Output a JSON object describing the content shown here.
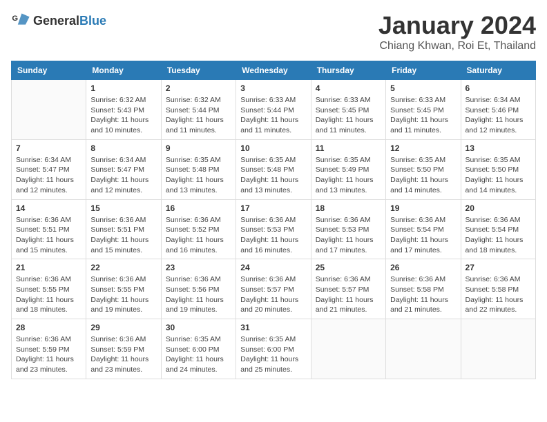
{
  "header": {
    "logo_general": "General",
    "logo_blue": "Blue",
    "month_title": "January 2024",
    "location": "Chiang Khwan, Roi Et, Thailand"
  },
  "days_of_week": [
    "Sunday",
    "Monday",
    "Tuesday",
    "Wednesday",
    "Thursday",
    "Friday",
    "Saturday"
  ],
  "weeks": [
    [
      {
        "day": "",
        "info": ""
      },
      {
        "day": "1",
        "info": "Sunrise: 6:32 AM\nSunset: 5:43 PM\nDaylight: 11 hours\nand 10 minutes."
      },
      {
        "day": "2",
        "info": "Sunrise: 6:32 AM\nSunset: 5:44 PM\nDaylight: 11 hours\nand 11 minutes."
      },
      {
        "day": "3",
        "info": "Sunrise: 6:33 AM\nSunset: 5:44 PM\nDaylight: 11 hours\nand 11 minutes."
      },
      {
        "day": "4",
        "info": "Sunrise: 6:33 AM\nSunset: 5:45 PM\nDaylight: 11 hours\nand 11 minutes."
      },
      {
        "day": "5",
        "info": "Sunrise: 6:33 AM\nSunset: 5:45 PM\nDaylight: 11 hours\nand 11 minutes."
      },
      {
        "day": "6",
        "info": "Sunrise: 6:34 AM\nSunset: 5:46 PM\nDaylight: 11 hours\nand 12 minutes."
      }
    ],
    [
      {
        "day": "7",
        "info": "Sunrise: 6:34 AM\nSunset: 5:47 PM\nDaylight: 11 hours\nand 12 minutes."
      },
      {
        "day": "8",
        "info": "Sunrise: 6:34 AM\nSunset: 5:47 PM\nDaylight: 11 hours\nand 12 minutes."
      },
      {
        "day": "9",
        "info": "Sunrise: 6:35 AM\nSunset: 5:48 PM\nDaylight: 11 hours\nand 13 minutes."
      },
      {
        "day": "10",
        "info": "Sunrise: 6:35 AM\nSunset: 5:48 PM\nDaylight: 11 hours\nand 13 minutes."
      },
      {
        "day": "11",
        "info": "Sunrise: 6:35 AM\nSunset: 5:49 PM\nDaylight: 11 hours\nand 13 minutes."
      },
      {
        "day": "12",
        "info": "Sunrise: 6:35 AM\nSunset: 5:50 PM\nDaylight: 11 hours\nand 14 minutes."
      },
      {
        "day": "13",
        "info": "Sunrise: 6:35 AM\nSunset: 5:50 PM\nDaylight: 11 hours\nand 14 minutes."
      }
    ],
    [
      {
        "day": "14",
        "info": "Sunrise: 6:36 AM\nSunset: 5:51 PM\nDaylight: 11 hours\nand 15 minutes."
      },
      {
        "day": "15",
        "info": "Sunrise: 6:36 AM\nSunset: 5:51 PM\nDaylight: 11 hours\nand 15 minutes."
      },
      {
        "day": "16",
        "info": "Sunrise: 6:36 AM\nSunset: 5:52 PM\nDaylight: 11 hours\nand 16 minutes."
      },
      {
        "day": "17",
        "info": "Sunrise: 6:36 AM\nSunset: 5:53 PM\nDaylight: 11 hours\nand 16 minutes."
      },
      {
        "day": "18",
        "info": "Sunrise: 6:36 AM\nSunset: 5:53 PM\nDaylight: 11 hours\nand 17 minutes."
      },
      {
        "day": "19",
        "info": "Sunrise: 6:36 AM\nSunset: 5:54 PM\nDaylight: 11 hours\nand 17 minutes."
      },
      {
        "day": "20",
        "info": "Sunrise: 6:36 AM\nSunset: 5:54 PM\nDaylight: 11 hours\nand 18 minutes."
      }
    ],
    [
      {
        "day": "21",
        "info": "Sunrise: 6:36 AM\nSunset: 5:55 PM\nDaylight: 11 hours\nand 18 minutes."
      },
      {
        "day": "22",
        "info": "Sunrise: 6:36 AM\nSunset: 5:55 PM\nDaylight: 11 hours\nand 19 minutes."
      },
      {
        "day": "23",
        "info": "Sunrise: 6:36 AM\nSunset: 5:56 PM\nDaylight: 11 hours\nand 19 minutes."
      },
      {
        "day": "24",
        "info": "Sunrise: 6:36 AM\nSunset: 5:57 PM\nDaylight: 11 hours\nand 20 minutes."
      },
      {
        "day": "25",
        "info": "Sunrise: 6:36 AM\nSunset: 5:57 PM\nDaylight: 11 hours\nand 21 minutes."
      },
      {
        "day": "26",
        "info": "Sunrise: 6:36 AM\nSunset: 5:58 PM\nDaylight: 11 hours\nand 21 minutes."
      },
      {
        "day": "27",
        "info": "Sunrise: 6:36 AM\nSunset: 5:58 PM\nDaylight: 11 hours\nand 22 minutes."
      }
    ],
    [
      {
        "day": "28",
        "info": "Sunrise: 6:36 AM\nSunset: 5:59 PM\nDaylight: 11 hours\nand 23 minutes."
      },
      {
        "day": "29",
        "info": "Sunrise: 6:36 AM\nSunset: 5:59 PM\nDaylight: 11 hours\nand 23 minutes."
      },
      {
        "day": "30",
        "info": "Sunrise: 6:35 AM\nSunset: 6:00 PM\nDaylight: 11 hours\nand 24 minutes."
      },
      {
        "day": "31",
        "info": "Sunrise: 6:35 AM\nSunset: 6:00 PM\nDaylight: 11 hours\nand 25 minutes."
      },
      {
        "day": "",
        "info": ""
      },
      {
        "day": "",
        "info": ""
      },
      {
        "day": "",
        "info": ""
      }
    ]
  ]
}
